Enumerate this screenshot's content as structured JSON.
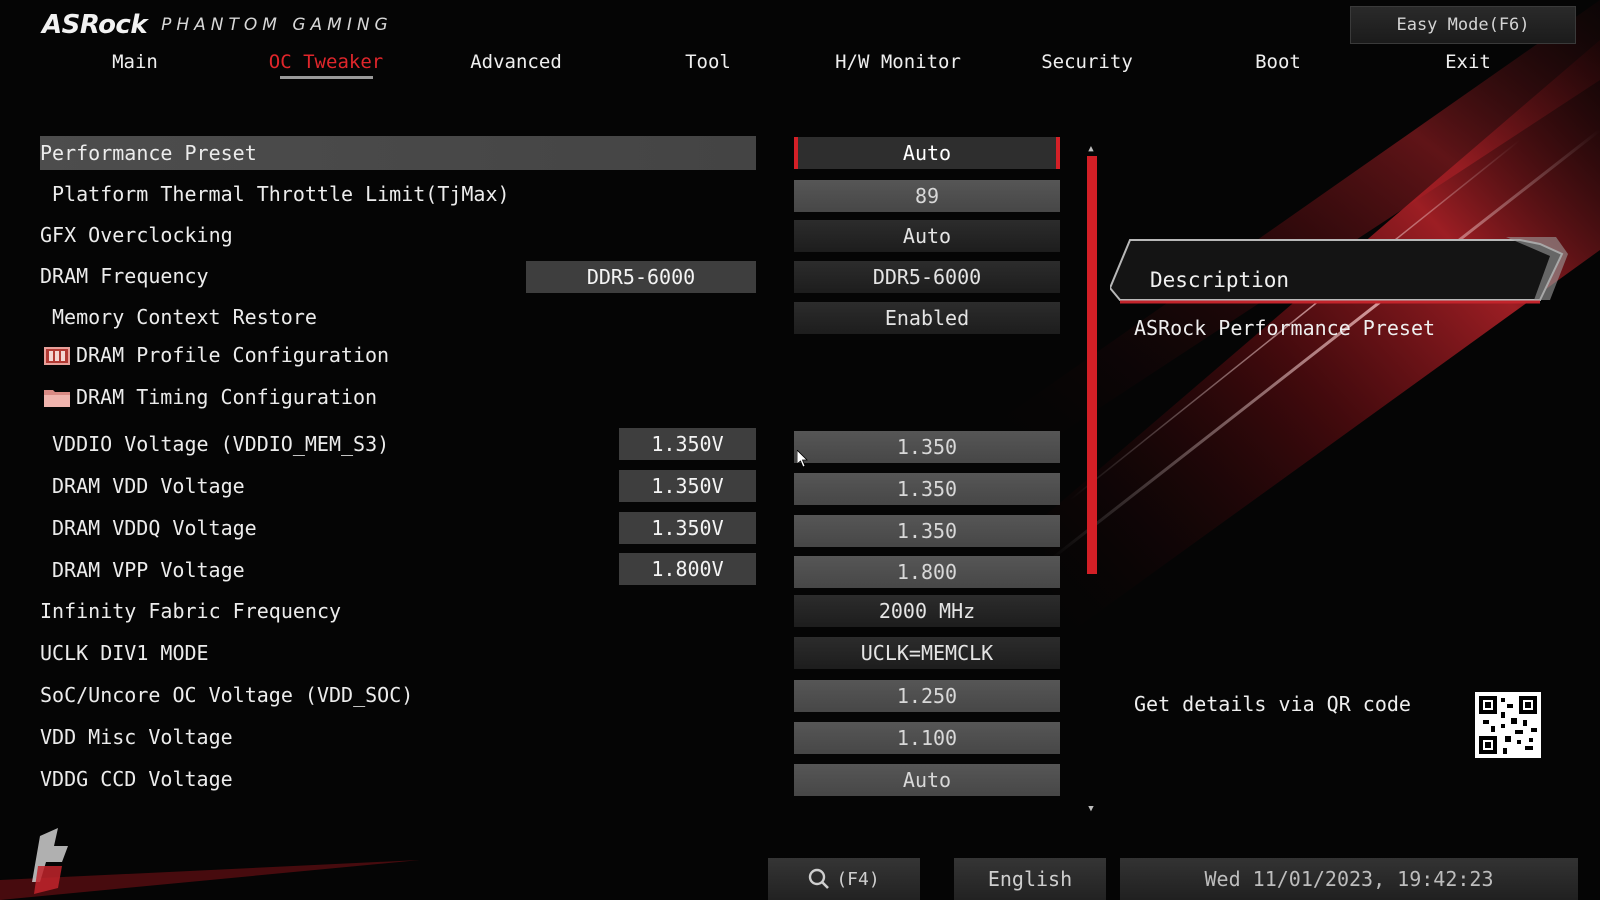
{
  "brand": {
    "name": "ASRock",
    "sub": "PHANTOM GAMING"
  },
  "easy_mode_label": "Easy Mode(F6)",
  "nav": {
    "tabs": [
      {
        "label": "Main"
      },
      {
        "label": "OC Tweaker",
        "active": true
      },
      {
        "label": "Advanced"
      },
      {
        "label": "Tool"
      },
      {
        "label": "H/W Monitor"
      },
      {
        "label": "Security"
      },
      {
        "label": "Boot"
      },
      {
        "label": "Exit"
      }
    ]
  },
  "settings": [
    {
      "label": "Performance Preset",
      "value": "Auto",
      "selected": true
    },
    {
      "label": "Platform Thermal Throttle Limit(TjMax)",
      "value": "89"
    },
    {
      "label": "GFX Overclocking",
      "value": "Auto"
    },
    {
      "label": "DRAM Frequency",
      "current": "DDR5-6000",
      "value": "DDR5-6000"
    },
    {
      "label": "Memory Context Restore",
      "value": "Enabled"
    },
    {
      "label": "DRAM Profile Configuration",
      "icon": "folder-icon"
    },
    {
      "label": "DRAM Timing Configuration",
      "icon": "folder-icon"
    },
    {
      "label": "VDDIO Voltage (VDDIO_MEM_S3)",
      "current": "1.350V",
      "value": "1.350"
    },
    {
      "label": "DRAM VDD Voltage",
      "current": "1.350V",
      "value": "1.350"
    },
    {
      "label": "DRAM VDDQ Voltage",
      "current": "1.350V",
      "value": "1.350"
    },
    {
      "label": "DRAM VPP Voltage",
      "current": "1.800V",
      "value": "1.800"
    },
    {
      "label": "Infinity Fabric Frequency",
      "value": "2000 MHz"
    },
    {
      "label": "UCLK DIV1 MODE",
      "value": "UCLK=MEMCLK"
    },
    {
      "label": "SoC/Uncore OC Voltage (VDD_SOC)",
      "value": "1.250"
    },
    {
      "label": "VDD Misc Voltage",
      "value": "1.100"
    },
    {
      "label": "VDDG CCD Voltage",
      "value": "Auto"
    }
  ],
  "description": {
    "title": "Description",
    "text": "ASRock Performance Preset",
    "qr_text": "Get details via QR code"
  },
  "bottom": {
    "search_label": "(F4)",
    "language": "English",
    "datetime": "Wed 11/01/2023, 19:42:23"
  },
  "colors": {
    "accent": "#d42027",
    "background": "#050505"
  }
}
